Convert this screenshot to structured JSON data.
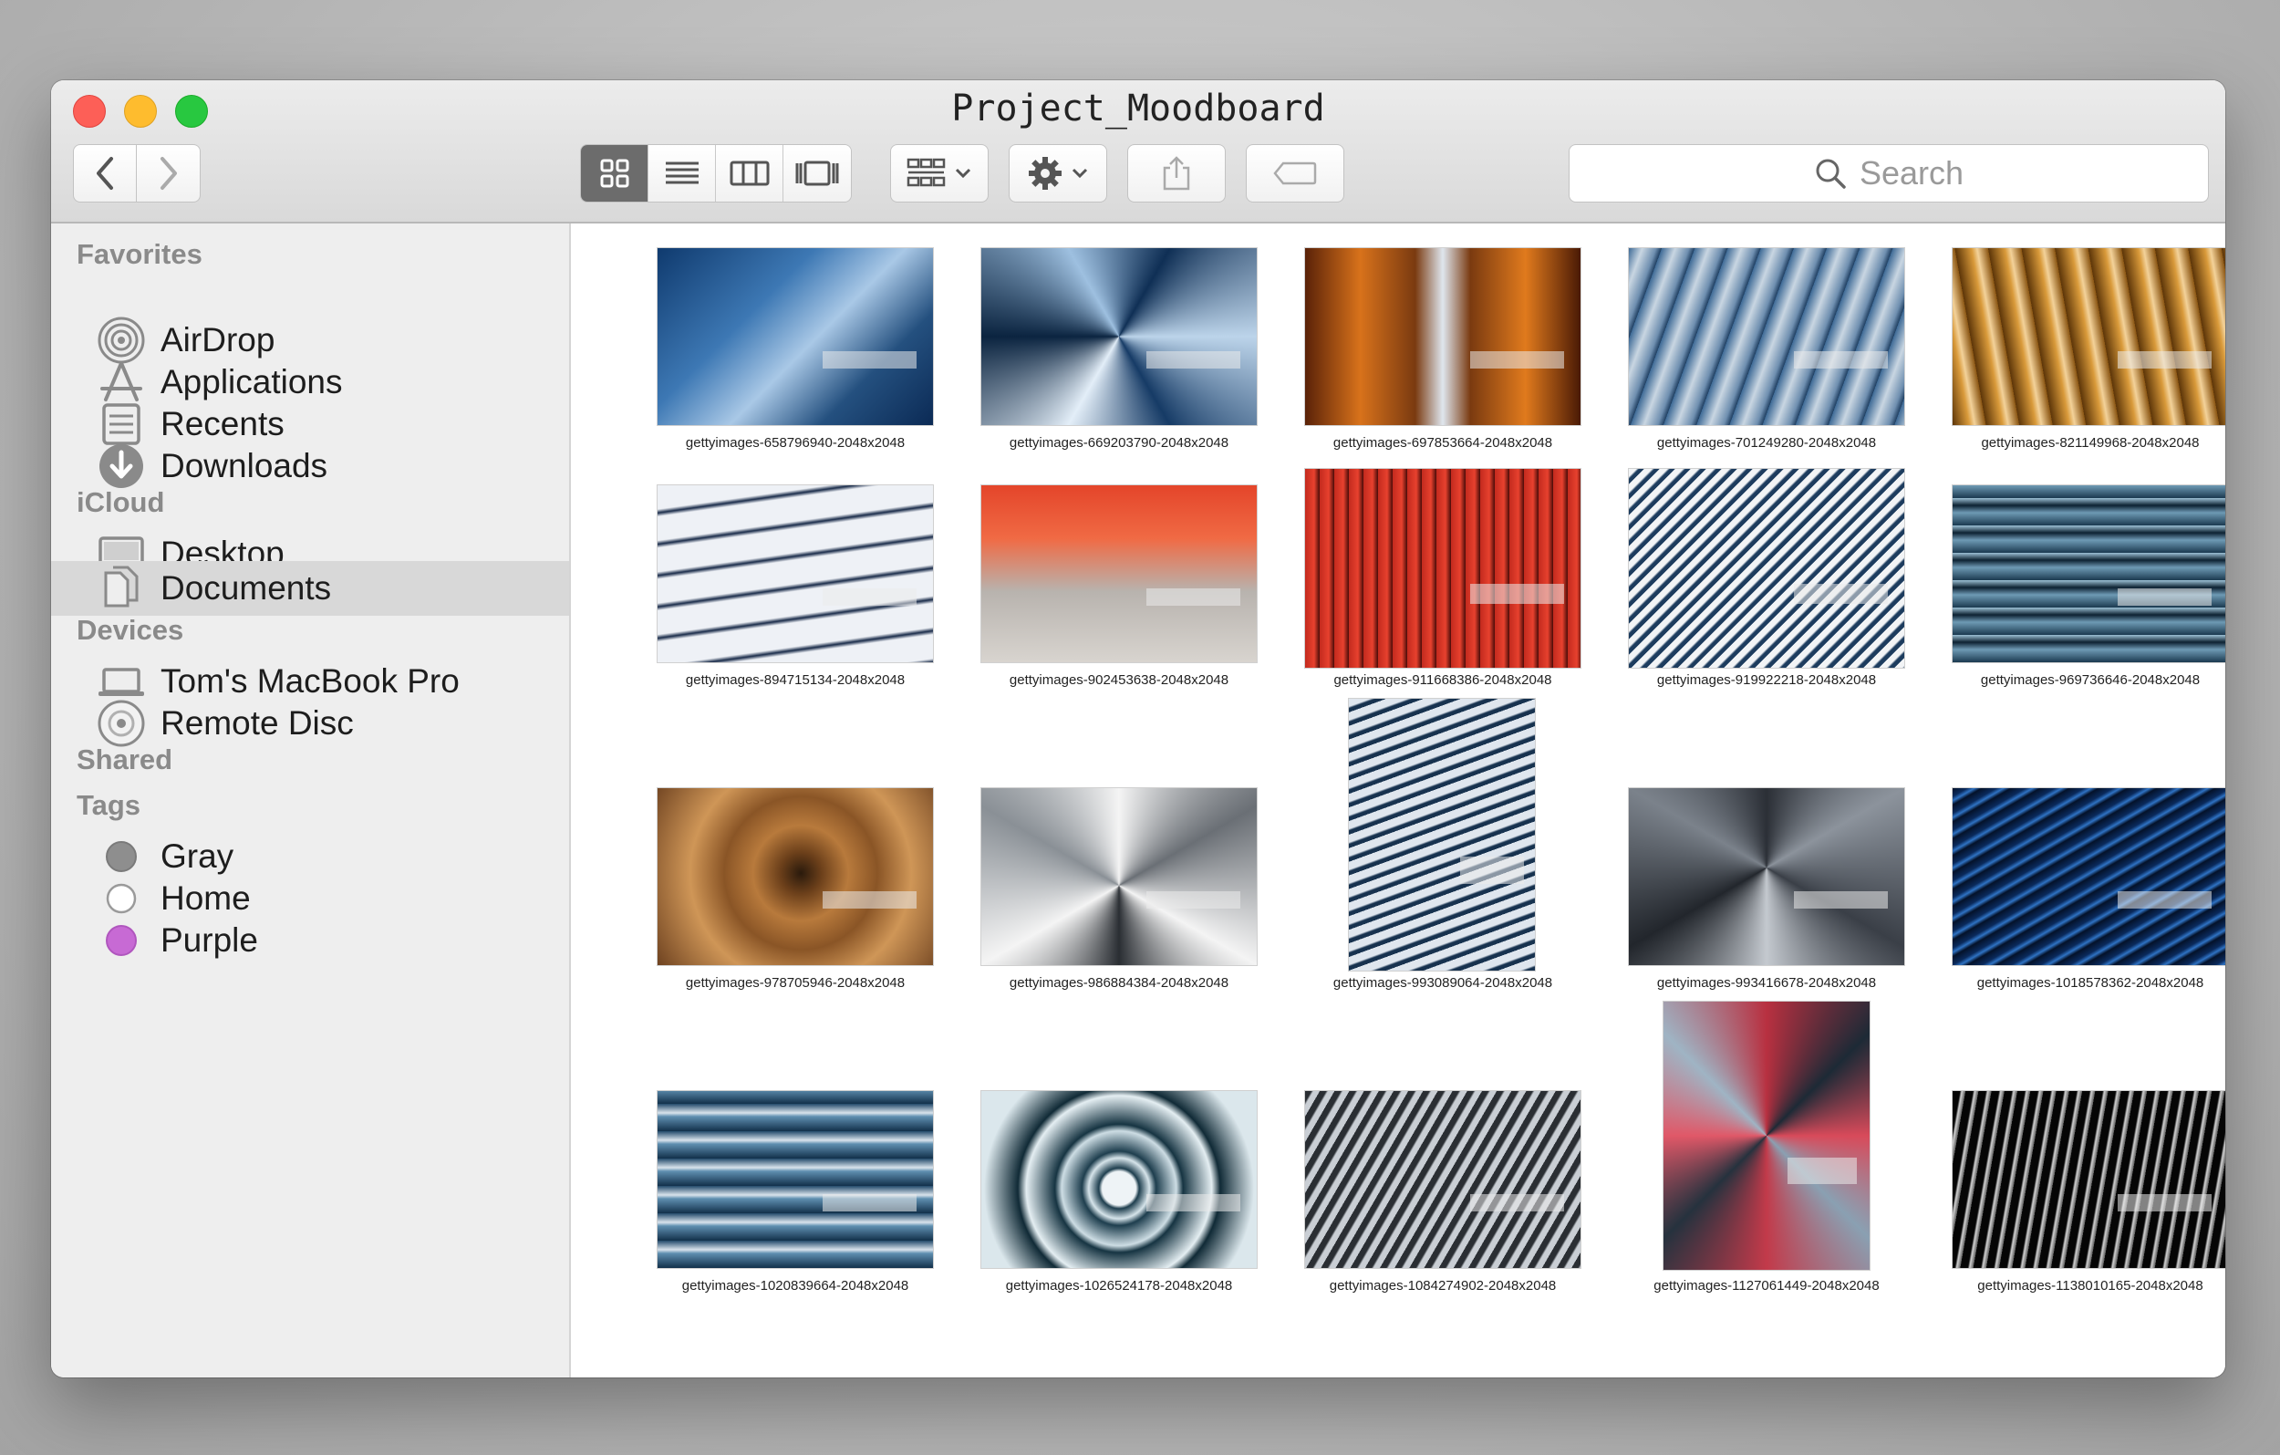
{
  "window": {
    "title": "Project_Moodboard"
  },
  "toolbar": {
    "back_icon": "chevron-left-icon",
    "forward_icon": "chevron-right-icon",
    "view_modes": [
      "icon-view",
      "list-view",
      "column-view",
      "gallery-view"
    ],
    "active_view": "icon-view",
    "group_by_icon": "group-grid-icon",
    "action_icon": "gear-icon",
    "share_icon": "share-icon",
    "tag_icon": "tag-icon",
    "search_placeholder": "Search"
  },
  "sidebar": {
    "favorites_label": "Favorites",
    "favorites": [
      {
        "label": "AirDrop",
        "icon": "airdrop-icon"
      },
      {
        "label": "Applications",
        "icon": "applications-icon"
      },
      {
        "label": "Recents",
        "icon": "recents-icon"
      },
      {
        "label": "Downloads",
        "icon": "downloads-icon"
      }
    ],
    "icloud_label": "iCloud",
    "icloud": [
      {
        "label": "Desktop",
        "icon": "desktop-icon"
      },
      {
        "label": "Documents",
        "icon": "documents-icon",
        "selected": true
      }
    ],
    "devices_label": "Devices",
    "devices": [
      {
        "label": "Tom's MacBook Pro",
        "icon": "laptop-icon"
      },
      {
        "label": "Remote Disc",
        "icon": "disc-icon"
      }
    ],
    "shared_label": "Shared",
    "tags_label": "Tags",
    "tags": [
      {
        "label": "Gray",
        "color": "#8e8e8e"
      },
      {
        "label": "Home",
        "color": "#ffffff"
      },
      {
        "label": "Purple",
        "color": "#c76ad4"
      }
    ]
  },
  "files": [
    {
      "name": "gettyimages-658796940-2048x2048"
    },
    {
      "name": "gettyimages-669203790-2048x2048"
    },
    {
      "name": "gettyimages-697853664-2048x2048"
    },
    {
      "name": "gettyimages-701249280-2048x2048"
    },
    {
      "name": "gettyimages-821149968-2048x2048"
    },
    {
      "name": "gettyimages-894715134-2048x2048"
    },
    {
      "name": "gettyimages-902453638-2048x2048"
    },
    {
      "name": "gettyimages-911668386-2048x2048"
    },
    {
      "name": "gettyimages-919922218-2048x2048"
    },
    {
      "name": "gettyimages-969736646-2048x2048"
    },
    {
      "name": "gettyimages-978705946-2048x2048"
    },
    {
      "name": "gettyimages-986884384-2048x2048"
    },
    {
      "name": "gettyimages-993089064-2048x2048"
    },
    {
      "name": "gettyimages-993416678-2048x2048"
    },
    {
      "name": "gettyimages-1018578362-2048x2048"
    },
    {
      "name": "gettyimages-1020839664-2048x2048"
    },
    {
      "name": "gettyimages-1026524178-2048x2048"
    },
    {
      "name": "gettyimages-1084274902-2048x2048"
    },
    {
      "name": "gettyimages-1127061449-2048x2048"
    },
    {
      "name": "gettyimages-1138010165-2048x2048"
    }
  ]
}
